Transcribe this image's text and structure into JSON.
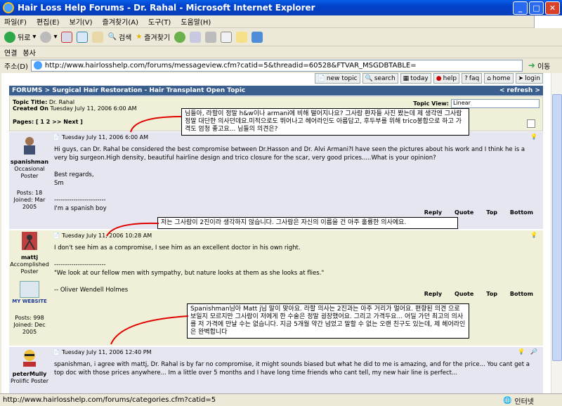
{
  "window": {
    "title": "Hair Loss Help Forums - Dr. Rahal - Microsoft Internet Explorer"
  },
  "menu": [
    "파일(F)",
    "편집(E)",
    "보기(V)",
    "즐겨찾기(A)",
    "도구(T)",
    "도움말(H)"
  ],
  "toolbar": {
    "back": "뒤로",
    "search": "검색",
    "favorites": "즐겨찾기"
  },
  "links": {
    "label": "연결",
    "item": "봉사"
  },
  "address": {
    "label": "주소(D)",
    "url": "http://www.hairlosshelp.com/forums/messageview.cfm?catid=5&threadid=60528&FTVAR_MSGDBTABLE=",
    "go": "이동"
  },
  "forum": {
    "nav": [
      "new topic",
      "search",
      "today",
      "help",
      "faq",
      "home",
      "login"
    ],
    "breadcrumb": "FORUMS > Surgical Hair Restoration - Hair Transplant Open Topic",
    "refresh": "< refresh >",
    "topic_title_label": "Topic Title:",
    "topic_title": "Dr. Rahal",
    "created_label": "Created On",
    "created": "Tuesday July 11, 2006 6:00 AM",
    "pages": "Pages: [ 1 2 >> Next ]",
    "topic_view_label": "Topic View:",
    "topic_view_value": "Linear"
  },
  "posts": [
    {
      "date": "Tuesday July 11, 2006 6:00 AM",
      "user": "spanishman",
      "rank": "Occasional Poster",
      "posts": "Posts: 18",
      "joined": "Joined: Mar 2005",
      "body": [
        "Hi guys, can Dr. Rahal be considered the best compromise between Dr.Hasson and Dr. Alvi Armani?I have seen the pictures about his work and I think he is a very big surgeon.High density, beautiful hairline design and trico closure for the scar, very good prices.....What is your opinion?",
        "Best regards,",
        "Sm",
        "------------------------",
        "I'm a spanish boy"
      ],
      "footer": [
        "Reply",
        "Quote",
        "Top",
        "Bottom"
      ]
    },
    {
      "date": "Tuesday July 11, 2006 10:28 AM",
      "user": "mattj",
      "rank": "Accomplished Poster",
      "website": "MY WEBSITE",
      "posts": "Posts: 998",
      "joined": "Joined: Dec 2005",
      "body": [
        "I don't see him as a compromise, I see him as an excellent doctor in his own right.",
        "------------------------",
        "\"We look at our fellow men with sympathy, but nature looks at them as she looks at flies.\"",
        "-- Oliver Wendell Holmes"
      ],
      "footer": [
        "Reply",
        "Quote",
        "Top",
        "Bottom"
      ]
    },
    {
      "date": "Tuesday July 11, 2006 12:40 PM",
      "user": "peterMully",
      "rank": "Prolific Poster",
      "body": [
        "spanishman, i agree with mattj, Dr. Rahal is by far no compromise, it might sounds biased but what he did to me is amazing, and for the price... You cant get a top doc with those prices anywhere... Im a little over 5 months and I have long time friends who cant tell, my new hair line is perfect..."
      ]
    }
  ],
  "annotations": [
    "님들아, 라할이 정말 h&w이나 armani에 비해 떨어지나요? 그사람 환자들 사진 봤는데 제 생각엔 그사람 정말 대단한 의사던데요.미적으로도 뛰어나고 헤어라인도 아름답고, 후두부를 위해 trico봉합으로 하고 가격도 엄청 좋고요... 님들의 의견은?",
    "저는 그사람이 2진이라 생각하지 않습니다. 그사람은 자신의 이름을 건 아주 훌륭한 의사에요.",
    "Spanishman님아 Matt j님 말이 맞아요. 라할 의사는 2진과는 아주 거리가 멀어요. 편향된 의견 으로 보일지 모르지만 그사람이 저에게 한 수술은 정말 굉장했어요. 그리고 가격두요... 어딜 가던 최고의 의사를 저 가격에 만날 수는 없습니다. 지금 5개월 약간 넘었고 말할 수 없는 오랜 친구도 있는데, 제 헤어라인은 완벽합니다"
  ],
  "status": {
    "url": "http://www.hairlosshelp.com/forums/categories.cfm?catid=5",
    "zone": "인터넷"
  }
}
